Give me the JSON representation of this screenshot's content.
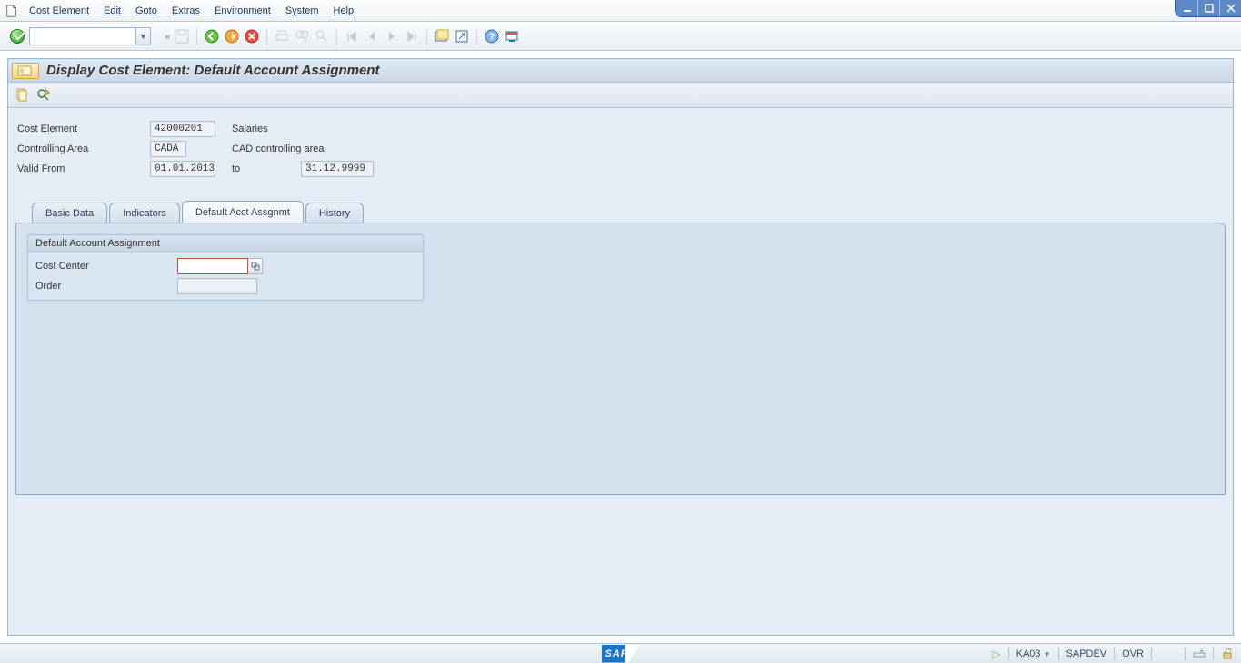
{
  "menu": [
    "Cost Element",
    "Edit",
    "Goto",
    "Extras",
    "Environment",
    "System",
    "Help"
  ],
  "page_title": "Display Cost Element: Default Account Assignment",
  "header": {
    "cost_element_label": "Cost Element",
    "cost_element_value": "42000201",
    "cost_element_desc": "Salaries",
    "controlling_area_label": "Controlling Area",
    "controlling_area_value": "CADA",
    "controlling_area_desc": "CAD controlling area",
    "valid_from_label": "Valid From",
    "valid_from_value": "01.01.2013",
    "valid_to_label": "to",
    "valid_to_value": "31.12.9999"
  },
  "tabs": {
    "basic": "Basic Data",
    "indicators": "Indicators",
    "default": "Default Acct Assgnmt",
    "history": "History"
  },
  "fieldset": {
    "title": "Default Account Assignment",
    "cost_center_label": "Cost Center",
    "cost_center_value": "",
    "order_label": "Order",
    "order_value": ""
  },
  "status": {
    "tcode": "KA03",
    "system": "SAPDEV",
    "mode": "OVR"
  }
}
